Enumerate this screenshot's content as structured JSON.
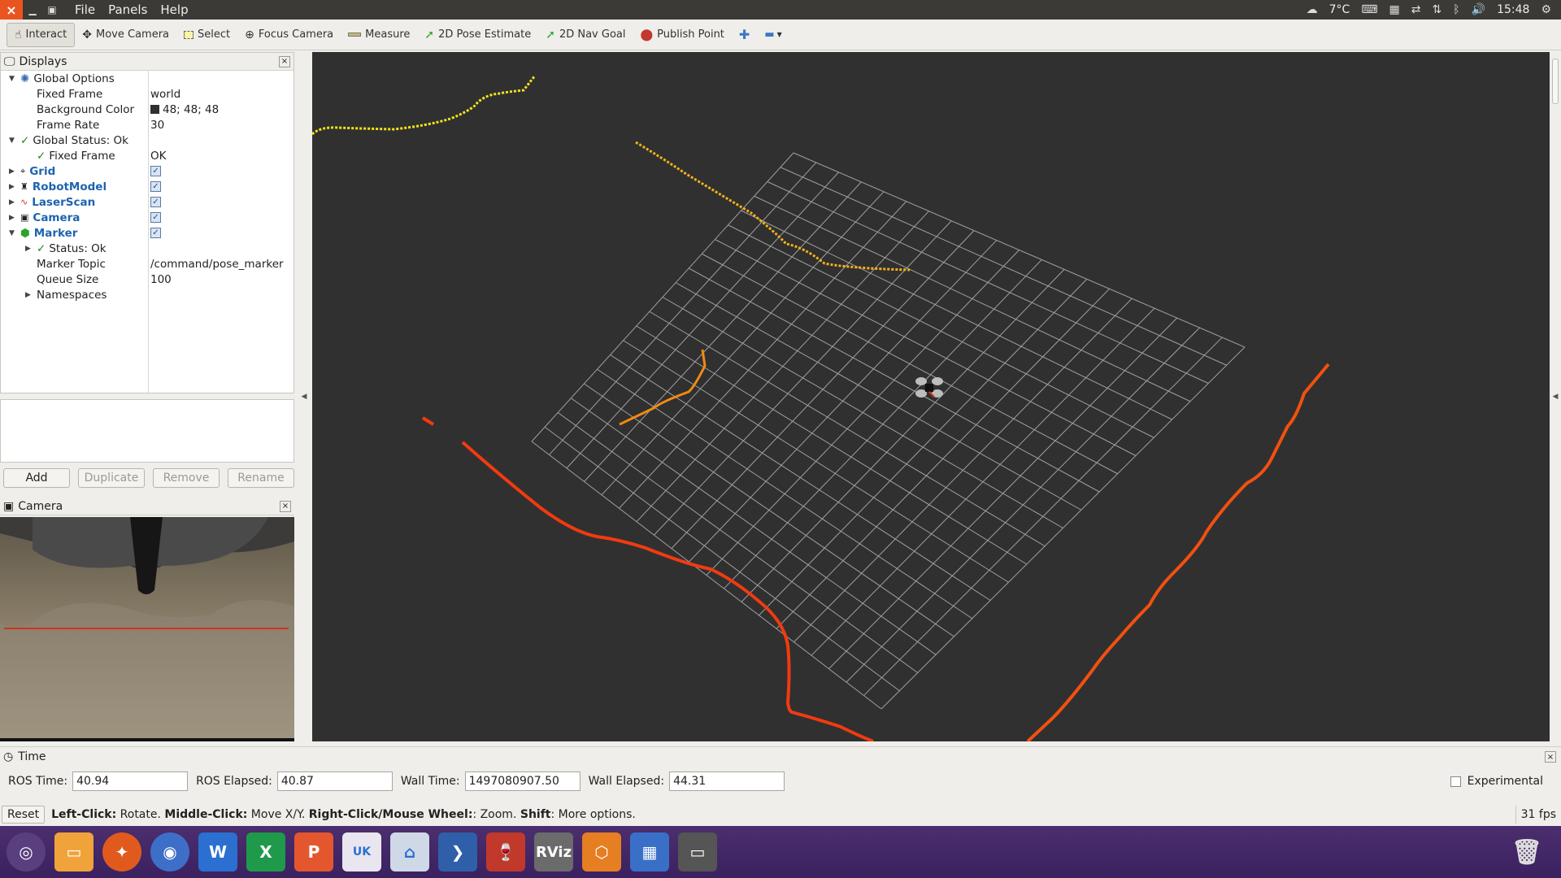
{
  "topbar": {
    "menu": [
      "File",
      "Panels",
      "Help"
    ],
    "temperature": "7°C",
    "clock": "15:48"
  },
  "toolbar": {
    "tools": [
      {
        "label": "Interact",
        "icon": "hand-icon"
      },
      {
        "label": "Move Camera",
        "icon": "move-camera-icon"
      },
      {
        "label": "Select",
        "icon": "select-icon"
      },
      {
        "label": "Focus Camera",
        "icon": "focus-camera-icon"
      },
      {
        "label": "Measure",
        "icon": "ruler-icon"
      },
      {
        "label": "2D Pose Estimate",
        "icon": "green-arrow-icon"
      },
      {
        "label": "2D Nav Goal",
        "icon": "green-arrow-icon"
      },
      {
        "label": "Publish Point",
        "icon": "map-pin-icon"
      }
    ]
  },
  "displays": {
    "title": "Displays",
    "global_options": {
      "label": "Global Options",
      "fixed_frame_label": "Fixed Frame",
      "fixed_frame_value": "world",
      "bg_color_label": "Background Color",
      "bg_color_value": "48; 48; 48",
      "frame_rate_label": "Frame Rate",
      "frame_rate_value": "30"
    },
    "global_status": {
      "label": "Global Status: Ok",
      "fixed_frame_label": "Fixed Frame",
      "fixed_frame_value": "OK"
    },
    "items": [
      "Grid",
      "RobotModel",
      "LaserScan",
      "Camera",
      "Marker"
    ],
    "marker": {
      "status_label": "Status: Ok",
      "topic_label": "Marker Topic",
      "topic_value": "/command/pose_marker",
      "queue_label": "Queue Size",
      "queue_value": "100",
      "namespaces_label": "Namespaces"
    },
    "buttons": {
      "add": "Add",
      "duplicate": "Duplicate",
      "remove": "Remove",
      "rename": "Rename"
    }
  },
  "camera_panel": {
    "title": "Camera"
  },
  "time_panel": {
    "title": "Time",
    "ros_time_label": "ROS Time:",
    "ros_time_value": "40.94",
    "ros_elapsed_label": "ROS Elapsed:",
    "ros_elapsed_value": "40.87",
    "wall_time_label": "Wall Time:",
    "wall_time_value": "1497080907.50",
    "wall_elapsed_label": "Wall Elapsed:",
    "wall_elapsed_value": "44.31",
    "experimental_label": "Experimental"
  },
  "statusbar": {
    "reset": "Reset",
    "h1b": "Left-Click:",
    "h1": " Rotate. ",
    "h2b": "Middle-Click:",
    "h2": " Move X/Y. ",
    "h3b": "Right-Click/Mouse Wheel:",
    "h3": ": Zoom. ",
    "h4b": "Shift",
    "h4": ": More options.",
    "fps": "31 fps"
  },
  "dock": {
    "rviz_label": "RViz",
    "uk_label": "UK"
  },
  "colors": {
    "viewport_bg": "#303030",
    "grid_line": "#a0a0a0",
    "trail_yellow": "#f2e21a",
    "trail_orange": "#f28a12",
    "trail_red": "#f23a10"
  }
}
